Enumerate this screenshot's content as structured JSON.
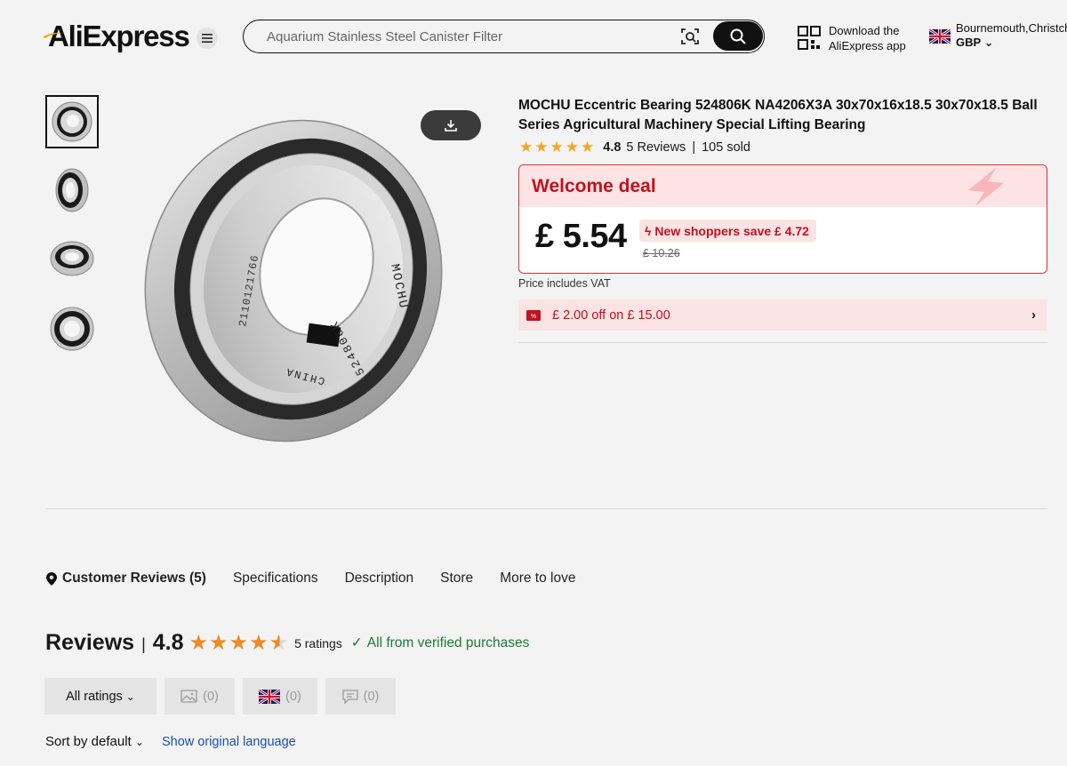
{
  "header": {
    "logo_text": "AliExpress",
    "search_value": "Aquarium Stainless Steel Canister Filter",
    "app_download": [
      "Download the",
      "AliExpress app"
    ],
    "region_location": "Bournemouth,Christch",
    "currency": "GBP"
  },
  "gallery": {
    "thumbnails": 4,
    "selected_index": 0
  },
  "product": {
    "title": "MOCHU Eccentric Bearing 524806K NA4206X3A 30x70x16x18.5 30x70x18.5 Ball Series Agricultural Machinery Special Lifting Bearing",
    "rating": "4.8",
    "reviews_label": "5 Reviews",
    "sold": "105 sold",
    "stars_filled": 5,
    "image_text": {
      "brand": "MOCHU",
      "serial": "2110121766",
      "model": "524806K",
      "origin": "CHINA"
    }
  },
  "deal": {
    "title": "Welcome deal",
    "price": "£ 5.54",
    "save_text": "New shoppers save £ 4.72",
    "old_price": "£ 10.26"
  },
  "vat_note": "Price includes VAT",
  "coupon": {
    "text": "£ 2.00 off on £ 15.00"
  },
  "tabs": [
    {
      "label": "Customer Reviews (5)"
    },
    {
      "label": "Specifications"
    },
    {
      "label": "Description"
    },
    {
      "label": "Store"
    },
    {
      "label": "More to love"
    }
  ],
  "reviews": {
    "title": "Reviews",
    "score": "4.8",
    "stars_value": 4.8,
    "count": "5 ratings",
    "verified": "All from verified purchases",
    "filters": {
      "all": "All ratings",
      "photo": "(0)",
      "uk": "(0)",
      "comment": "(0)"
    },
    "sort": "Sort by default",
    "show_original": "Show original language"
  },
  "colors": {
    "deal_red": "#c1121f",
    "deal_bg": "#fde3e4",
    "star_gold": "#f5a623",
    "star_orange": "#f08a24",
    "verified_green": "#1c7a35",
    "link_blue": "#1a4fa3"
  }
}
